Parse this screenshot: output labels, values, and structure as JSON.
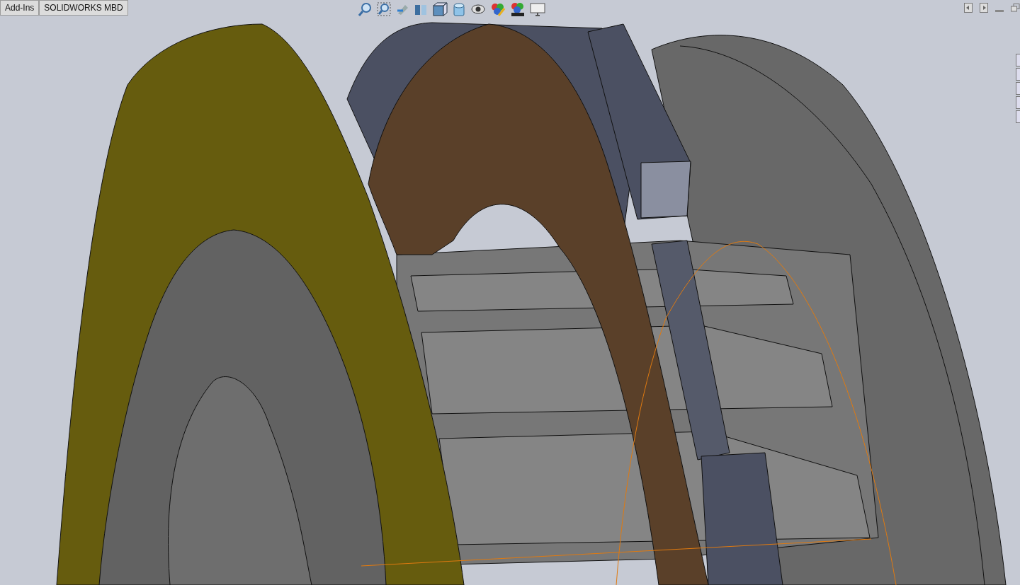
{
  "tabs": [
    {
      "label": "Add-Ins",
      "selected": false
    },
    {
      "label": "SOLIDWORKS MBD",
      "selected": false
    }
  ]
}
